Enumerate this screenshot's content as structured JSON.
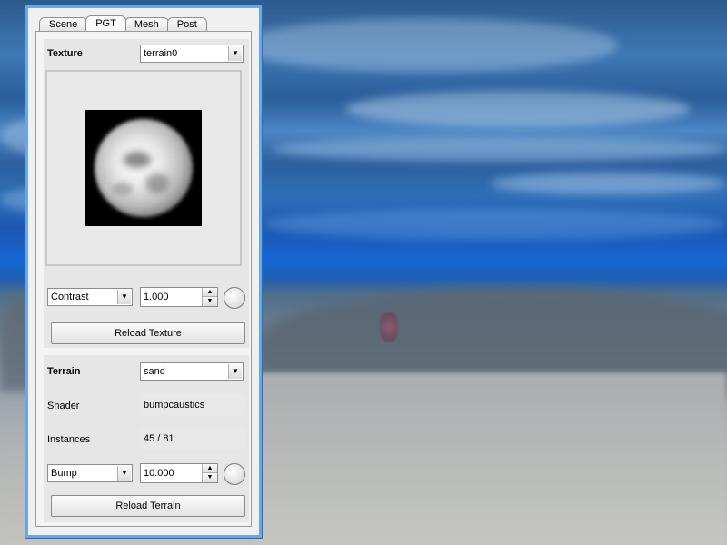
{
  "tabs": [
    "Scene",
    "PGT",
    "Mesh",
    "Post"
  ],
  "active_tab": "PGT",
  "texture": {
    "label": "Texture",
    "selected": "terrain0",
    "adjust_mode": "Contrast",
    "adjust_value": "1.000",
    "reload_label": "Reload Texture"
  },
  "terrain": {
    "label": "Terrain",
    "selected": "sand",
    "shader_label": "Shader",
    "shader_value": "bumpcaustics",
    "instances_label": "Instances",
    "instances_value": "45 / 81",
    "adjust_mode": "Bump",
    "adjust_value": "10.000",
    "reload_label": "Reload Terrain"
  },
  "icons": {
    "dropdown": "chevron-down-icon",
    "spin_up": "arrow-up-icon",
    "spin_down": "arrow-down-icon",
    "dial": "knob-icon"
  },
  "colors": {
    "window_border": "#6aa7e6",
    "panel_bg": "#f0f0f0"
  }
}
